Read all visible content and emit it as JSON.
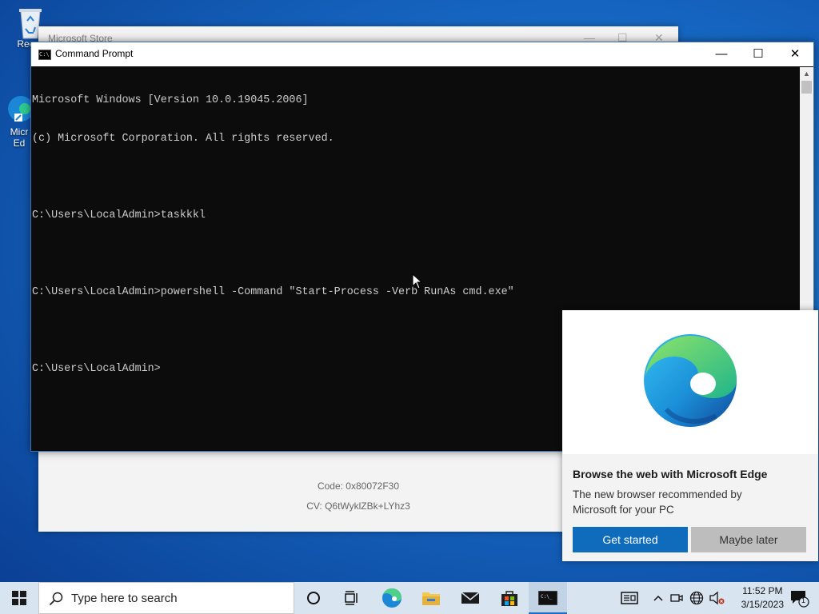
{
  "desktop": {
    "recycle_label": "Recyc",
    "edge_label_1": "Micr",
    "edge_label_2": "Ed"
  },
  "store_window": {
    "title": "Microsoft Store",
    "code": "Code: 0x80072F30",
    "cv": "CV: Q6tWyklZBk+LYhz3"
  },
  "cmd_window": {
    "title": "Command Prompt",
    "lines": [
      "Microsoft Windows [Version 10.0.19045.2006]",
      "(c) Microsoft Corporation. All rights reserved.",
      "",
      "C:\\Users\\LocalAdmin>taskkkl",
      "",
      "C:\\Users\\LocalAdmin>powershell -Command \"Start-Process -Verb RunAs cmd.exe\"",
      "",
      "C:\\Users\\LocalAdmin>"
    ]
  },
  "edge_promo": {
    "heading": "Browse the web with Microsoft Edge",
    "body": "The new browser recommended by Microsoft for your PC",
    "primary_button": "Get started",
    "secondary_button": "Maybe later"
  },
  "taskbar": {
    "search_placeholder": "Type here to search",
    "time": "11:52 PM",
    "date": "3/15/2023",
    "notification_count": "1"
  },
  "colors": {
    "accent": "#0f6cbd",
    "console_bg": "#0c0c0c",
    "console_fg": "#cccccc"
  }
}
